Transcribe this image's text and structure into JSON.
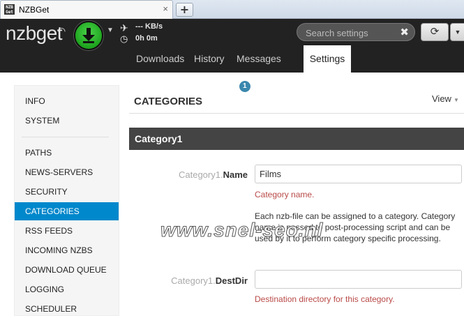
{
  "browser": {
    "tab_title": "NZBGet",
    "favicon_text": "NZB Get",
    "close_glyph": "×",
    "new_tab_glyph": "+"
  },
  "header": {
    "logo": "nzbget",
    "speed": "--- KB/s",
    "remaining_time": "0h 0m",
    "search_placeholder": "Search settings",
    "search_clear_glyph": "✖",
    "refresh_glyph": "⟳",
    "more_glyph": "▼",
    "menu": [
      {
        "label": "Downloads"
      },
      {
        "label": "History"
      },
      {
        "label": "Messages",
        "badge": "1"
      },
      {
        "label": "Settings",
        "active": true
      }
    ]
  },
  "sidebar": {
    "items": [
      {
        "label": "INFO"
      },
      {
        "label": "SYSTEM"
      },
      {
        "label": "PATHS"
      },
      {
        "label": "NEWS-SERVERS"
      },
      {
        "label": "SECURITY"
      },
      {
        "label": "CATEGORIES",
        "active": true
      },
      {
        "label": "RSS FEEDS"
      },
      {
        "label": "INCOMING NZBS"
      },
      {
        "label": "DOWNLOAD QUEUE"
      },
      {
        "label": "LOGGING"
      },
      {
        "label": "SCHEDULER"
      }
    ]
  },
  "main": {
    "title": "CATEGORIES",
    "view_label": "View",
    "section": "Category1",
    "options": [
      {
        "prefix": "Category1.",
        "name": "Name",
        "value": "Films",
        "hint": "Category name.",
        "description": "Each nzb-file can be assigned to a category. Category name is passed to post-processing script and can be used by it to perform category specific processing."
      },
      {
        "prefix": "Category1.",
        "name": "DestDir",
        "value": "",
        "hint": "Destination directory for this category."
      }
    ]
  },
  "watermark": "www.snel-seo.nl",
  "colors": {
    "navbar": "#222222",
    "accent": "#0088cc",
    "section_bar": "#444444",
    "hint_red": "#b94a48",
    "download_green": "#1ea31e"
  },
  "icons": [
    "wifi-icon",
    "download-arrow-icon",
    "plane-icon",
    "clock-icon",
    "close-icon",
    "refresh-icon",
    "chevron-down-icon"
  ]
}
